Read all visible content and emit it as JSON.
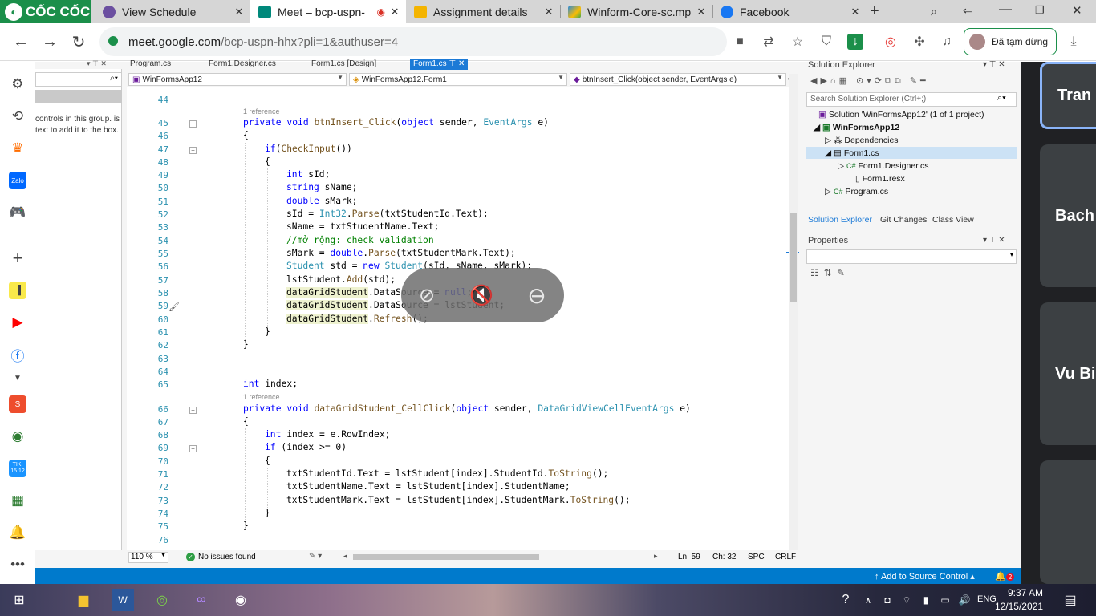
{
  "browser": {
    "brand": "CỐC CỐC",
    "tabs": [
      {
        "label": "View Schedule",
        "icon": "schedule-icon",
        "color": "#6b4fa0"
      },
      {
        "label": "Meet – bcp-uspn-",
        "icon": "meet-icon",
        "color": "#00897b"
      },
      {
        "label": "Assignment details",
        "icon": "classroom-icon",
        "color": "#f4b400"
      },
      {
        "label": "Winform-Core-sc.mp",
        "icon": "drive-icon",
        "color": "#1e88e5"
      },
      {
        "label": "Facebook",
        "icon": "facebook-icon",
        "color": "#1877f2"
      }
    ],
    "new_tab": "+",
    "url_host": "meet.google.com",
    "url_path": "/bcp-uspn-hhx?pli=1&authuser=4",
    "profile_status": "Đã tạm dừng",
    "accent": "#1b8f4a"
  },
  "vs": {
    "toolbox_text": "controls in this group. is text to add it to the box.",
    "doc_tabs": [
      "Program.cs",
      "Form1.Designer.cs",
      "Form1.cs [Design]",
      "Form1.cs"
    ],
    "nav": [
      "WinFormsApp12",
      "WinFormsApp12.Form1",
      "btnInsert_Click(object sender, EventArgs e)"
    ],
    "status_zoom": "110 %",
    "status_issues": "No issues found",
    "status_ln": "Ln: 59",
    "status_ch": "Ch: 32",
    "status_spc": "SPC",
    "status_crlf": "CRLF",
    "add_to_source": "Add to Source Control",
    "notif_count": "2"
  },
  "code_refs": [
    "1 reference",
    "1 reference"
  ],
  "solution": {
    "title": "Solution Explorer",
    "search": "Search Solution Explorer (Ctrl+;)",
    "items": [
      "Solution 'WinFormsApp12' (1 of 1 project)",
      "WinFormsApp12",
      "Dependencies",
      "Form1.cs",
      "Form1.Designer.cs",
      "Form1.resx",
      "Program.cs"
    ],
    "tabs": [
      "Solution Explorer",
      "Git Changes",
      "Class View"
    ],
    "props_title": "Properties"
  },
  "meet": {
    "participants": [
      "Tran",
      "Bach",
      "Vu Bi"
    ]
  },
  "taskbar": {
    "lang": "ENG",
    "time": "9:37 AM",
    "date": "12/15/2021"
  }
}
